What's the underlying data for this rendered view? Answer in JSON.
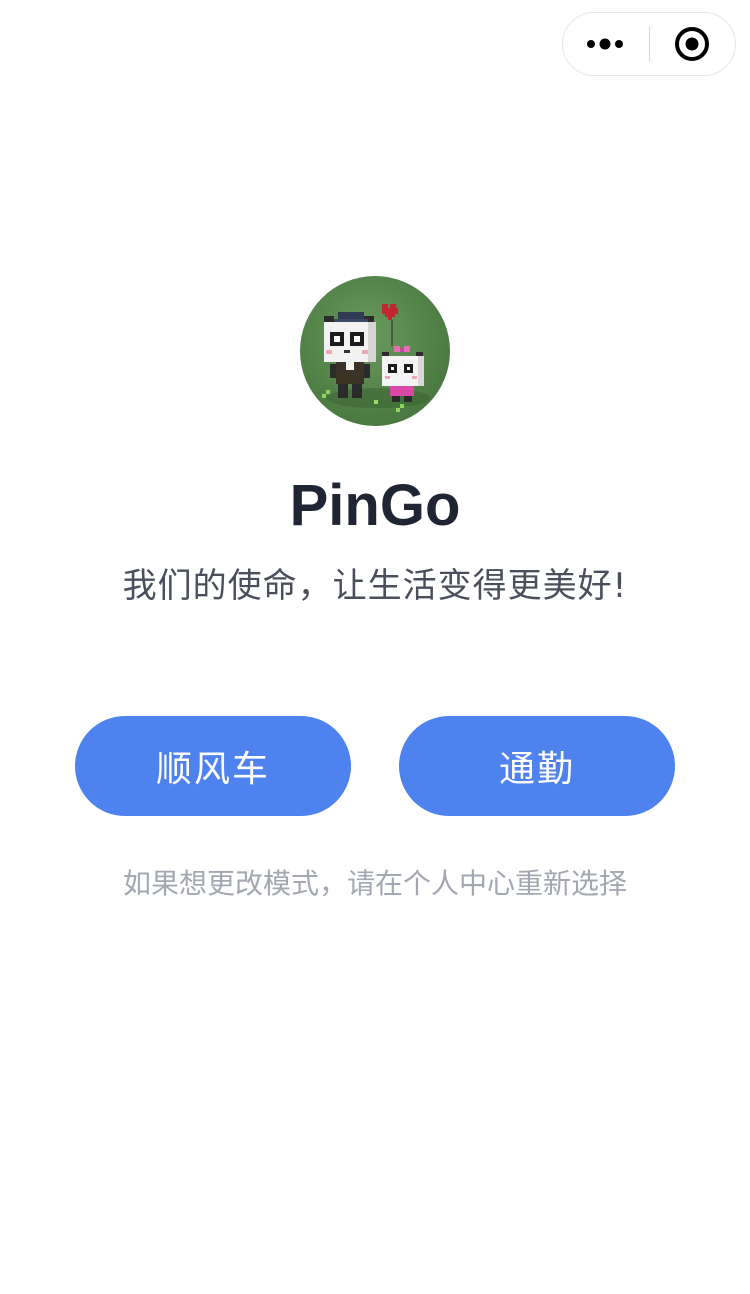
{
  "capsule": {
    "more_icon": "more-dots-icon",
    "close_icon": "target-circle-icon"
  },
  "avatar": {
    "icon": "panda-couple-avatar"
  },
  "app": {
    "title": "PinGo",
    "slogan": "我们的使命，让生活变得更美好!"
  },
  "modes": {
    "hitchhike_label": "顺风车",
    "commute_label": "通勤"
  },
  "hint": "如果想更改模式，请在个人中心重新选择",
  "colors": {
    "accent": "#4e82ee",
    "title": "#1f2533",
    "slogan": "#4a4f5c",
    "hint": "#a3a7b1"
  }
}
